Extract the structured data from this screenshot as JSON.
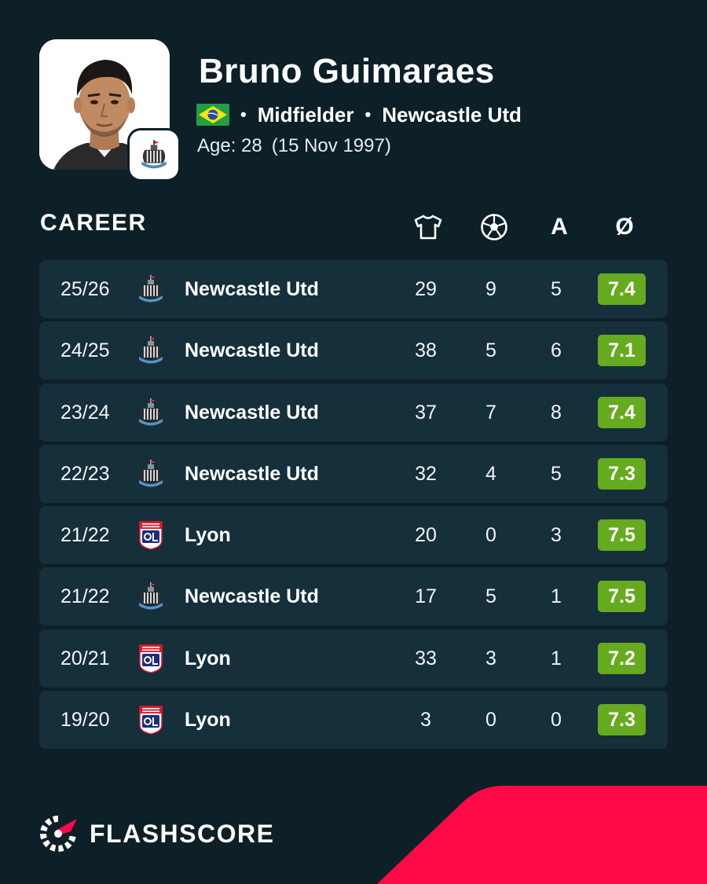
{
  "player": {
    "name": "Bruno Guimaraes",
    "position": "Midfielder",
    "team": "Newcastle Utd",
    "age": "Age: 28",
    "dob": "(15 Nov 1997)",
    "nationality_flag": "brazil-flag-icon"
  },
  "career": {
    "title": "CAREER",
    "columns": {
      "apps_icon": "shirt-icon",
      "goals_icon": "ball-icon",
      "assists_label": "A",
      "rating_label": "Ø"
    },
    "rows": [
      {
        "season": "25/26",
        "team": "Newcastle Utd",
        "crest": "newcastle-crest-icon",
        "apps": "29",
        "goals": "9",
        "assists": "5",
        "rating": "7.4"
      },
      {
        "season": "24/25",
        "team": "Newcastle Utd",
        "crest": "newcastle-crest-icon",
        "apps": "38",
        "goals": "5",
        "assists": "6",
        "rating": "7.1"
      },
      {
        "season": "23/24",
        "team": "Newcastle Utd",
        "crest": "newcastle-crest-icon",
        "apps": "37",
        "goals": "7",
        "assists": "8",
        "rating": "7.4"
      },
      {
        "season": "22/23",
        "team": "Newcastle Utd",
        "crest": "newcastle-crest-icon",
        "apps": "32",
        "goals": "4",
        "assists": "5",
        "rating": "7.3"
      },
      {
        "season": "21/22",
        "team": "Lyon",
        "crest": "lyon-crest-icon",
        "apps": "20",
        "goals": "0",
        "assists": "3",
        "rating": "7.5"
      },
      {
        "season": "21/22",
        "team": "Newcastle Utd",
        "crest": "newcastle-crest-icon",
        "apps": "17",
        "goals": "5",
        "assists": "1",
        "rating": "7.5"
      },
      {
        "season": "20/21",
        "team": "Lyon",
        "crest": "lyon-crest-icon",
        "apps": "33",
        "goals": "3",
        "assists": "1",
        "rating": "7.2"
      },
      {
        "season": "19/20",
        "team": "Lyon",
        "crest": "lyon-crest-icon",
        "apps": "3",
        "goals": "0",
        "assists": "0",
        "rating": "7.3"
      }
    ]
  },
  "brand": {
    "name": "FLASHSCORE"
  },
  "colors": {
    "background": "#0d1f27",
    "row": "#152f3b",
    "rating": "#66aa1f",
    "accent": "#ff0a46"
  }
}
